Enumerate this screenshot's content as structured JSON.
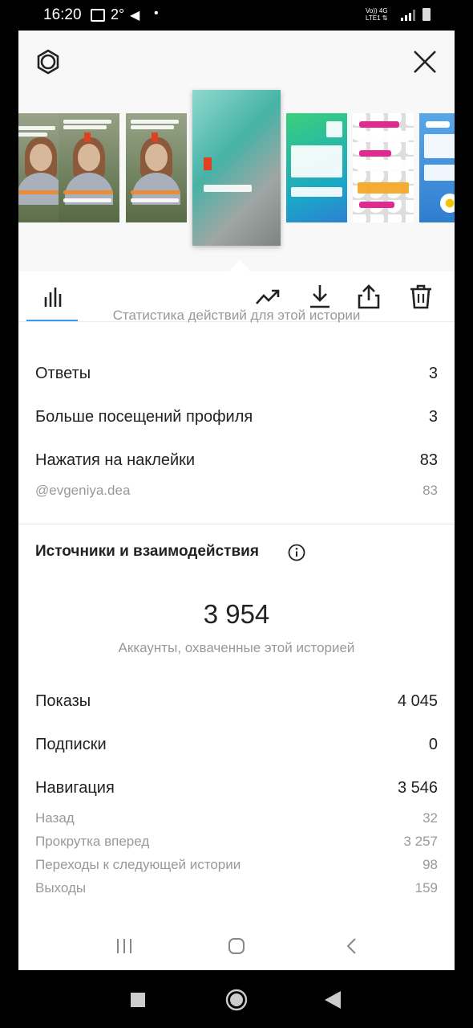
{
  "status_bar": {
    "time": "16:20",
    "temp": "2°",
    "telegram": "◀",
    "dot": "•",
    "net_top": "Vo)) 4G",
    "net_bottom": "LTE1 ⇅"
  },
  "header": {
    "settings_icon": "gear-icon",
    "close_icon": "close-icon"
  },
  "thumbnails": [
    {
      "type": "person",
      "bg": "#7d8f6a"
    },
    {
      "type": "person",
      "bg": "#6b7d58"
    },
    {
      "type": "person",
      "bg": "#6e805b"
    },
    {
      "type": "water",
      "bg": "#4fb3a8",
      "selected": true
    },
    {
      "type": "gradient",
      "bg": "#1bbf9a"
    },
    {
      "type": "stones",
      "bg": "#e9e2da"
    },
    {
      "type": "sky",
      "bg": "#3b8fd9"
    }
  ],
  "toolbar": {
    "icons": [
      "bar-chart-icon",
      "trending-icon",
      "download-icon",
      "share-icon",
      "trash-icon"
    ]
  },
  "activity": {
    "subtitle": "Статистика действий для этой истории",
    "rows": [
      {
        "label": "Ответы",
        "value": "3"
      },
      {
        "label": "Больше посещений профиля",
        "value": "3"
      },
      {
        "label": "Нажатия на наклейки",
        "value": "83"
      }
    ],
    "sticker": {
      "label": "@evgeniya.dea",
      "value": "83"
    }
  },
  "sources": {
    "title": "Источники и взаимодействия",
    "reach_value": "3 954",
    "reach_caption": "Аккаунты, охваченные этой историей",
    "rows": [
      {
        "label": "Показы",
        "value": "4 045"
      },
      {
        "label": "Подписки",
        "value": "0"
      },
      {
        "label": "Навигация",
        "value": "3 546"
      }
    ],
    "navigation": [
      {
        "label": "Назад",
        "value": "32"
      },
      {
        "label": "Прокрутка вперед",
        "value": "3 257"
      },
      {
        "label": "Переходы к следующей истории",
        "value": "98"
      },
      {
        "label": "Выходы",
        "value": "159"
      }
    ]
  },
  "colors": {
    "accent": "#3897f0",
    "text": "#222222",
    "muted": "#999999"
  }
}
